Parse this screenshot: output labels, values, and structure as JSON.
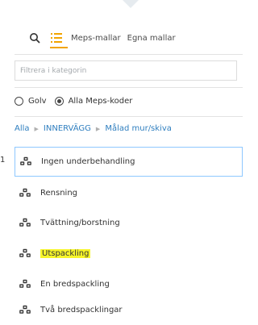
{
  "top": {
    "tabs": [
      {
        "label": "Meps-mallar"
      },
      {
        "label": "Egna mallar"
      }
    ]
  },
  "filter": {
    "placeholder": "Filtrera i kategorin"
  },
  "options": [
    {
      "label": "Golv",
      "selected": false
    },
    {
      "label": "Alla Meps-koder",
      "selected": true
    }
  ],
  "breadcrumb": [
    {
      "label": "Alla"
    },
    {
      "label": "INNERVÄGG"
    },
    {
      "label": "Målad mur/skiva"
    }
  ],
  "side_number": "1",
  "items": [
    {
      "label": "Ingen underbehandling",
      "selected": true,
      "highlighted": false
    },
    {
      "label": "Rensning",
      "selected": false,
      "highlighted": false
    },
    {
      "label": "Tvättning/borstning",
      "selected": false,
      "highlighted": false
    },
    {
      "label": "Utspackling",
      "selected": false,
      "highlighted": true
    },
    {
      "label": "En bredspackling",
      "selected": false,
      "highlighted": false
    },
    {
      "label": "Två bredspacklingar",
      "selected": false,
      "highlighted": false
    }
  ],
  "colors": {
    "accent": "#f2a400",
    "link": "#2e7ebf",
    "selected_border": "#8ec8ff",
    "highlight": "#f6f52a"
  }
}
